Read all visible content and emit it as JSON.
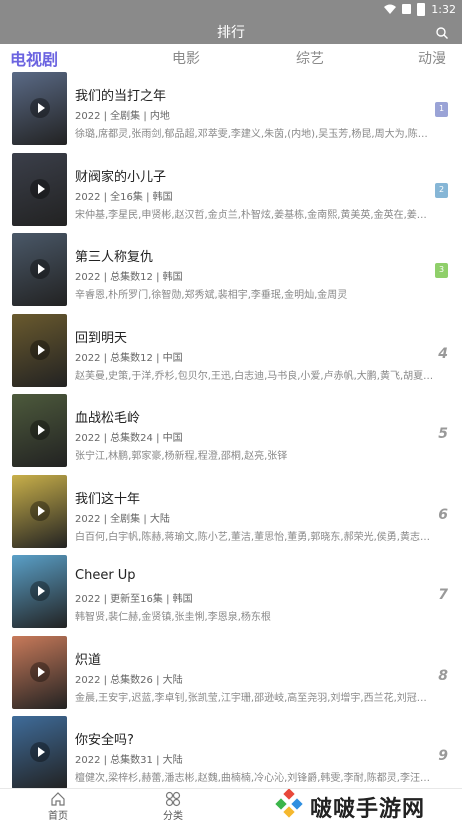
{
  "status_bar": {
    "time": "1:32"
  },
  "header": {
    "title": "排行",
    "search_icon": "search-icon"
  },
  "tabs": [
    {
      "label": "电视剧",
      "active": true
    },
    {
      "label": "电影",
      "active": false
    },
    {
      "label": "综艺",
      "active": false
    },
    {
      "label": "动漫",
      "active": false
    }
  ],
  "items": [
    {
      "title": "我们的当打之年",
      "meta": "2022 | 全剧集 | 内地",
      "cast": "徐璐,席都灵,张雨剑,郁品超,邓萃雯,李建义,朱茵,(内地),吴玉芳,杨昆,周大为,陈昊蕴",
      "rank": "1",
      "badge_color": "#9aa3d6",
      "poster_color": "#5a6a86"
    },
    {
      "title": "财阀家的小儿子",
      "meta": "2022 | 全16集 | 韩国",
      "cast": "宋仲基,李星民,申贤彬,赵汉哲,金贞兰,朴智炫,姜基栋,金南熙,黄美英,金英在,姜吉宇",
      "rank": "2",
      "badge_color": "#86b6d6",
      "poster_color": "#3b3f4a"
    },
    {
      "title": "第三人称复仇",
      "meta": "2022 | 总集数12 | 韩国",
      "cast": "辛睿恩,朴所罗门,徐智勋,郑秀斌,裴相宇,李垂珉,金明灿,金周灵",
      "rank": "3",
      "badge_color": "#8fcf6a",
      "poster_color": "#4a5868"
    },
    {
      "title": "回到明天",
      "meta": "2022 | 总集数12 | 中国",
      "cast": "赵芙曼,史策,于洋,乔杉,包贝尔,王迅,白志迪,马书良,小爱,卢赤帆,大鹏,黄飞,胡夏,白客,崔志佳",
      "rank": "4",
      "badge_color": "",
      "poster_color": "#6a5a2e"
    },
    {
      "title": "血战松毛岭",
      "meta": "2022 | 总集数24 | 中国",
      "cast": "张宁江,林鹏,郭家豪,杨新程,程澄,邵桐,赵亮,张铎",
      "rank": "5",
      "badge_color": "",
      "poster_color": "#4d5a3c"
    },
    {
      "title": "我们这十年",
      "meta": "2022 | 全剧集 | 大陆",
      "cast": "白百何,白宇帆,陈赫,蒋瑜文,陈小艺,董洁,董思怡,董勇,郭晓东,郝荣光,侯勇,黄志忠,焦俊艳",
      "rank": "6",
      "badge_color": "",
      "poster_color": "#c9b04a"
    },
    {
      "title": "Cheer Up",
      "meta": "2022 | 更新至16集 | 韩国",
      "cast": "韩智贤,裴仁赫,金贤镇,张圭悧,李恩泉,杨东根",
      "rank": "7",
      "badge_color": "",
      "poster_color": "#5aa0c8"
    },
    {
      "title": "炽道",
      "meta": "2022 | 总集数26 | 大陆",
      "cast": "金晨,王安宇,迟蓝,李卓钊,张凯莹,江宇珊,邵逊岐,高至尧羽,刘增宇,西兰花,刘冠成,徐浩儿",
      "rank": "8",
      "badge_color": "",
      "poster_color": "#c87a5a"
    },
    {
      "title": "你安全吗?",
      "meta": "2022 | 总集数31 | 大陆",
      "cast": "檀健次,梁梓杉,赫蕾,潘志彬,赵魏,曲楠楠,冷心沁,刘锋爵,韩雯,李耐,陈都灵,李汪霖,梁大维",
      "rank": "9",
      "badge_color": "",
      "poster_color": "#3f6c9a"
    }
  ],
  "bottom_nav": [
    {
      "label": "首页",
      "icon": "home-icon"
    },
    {
      "label": "分类",
      "icon": "category-icon"
    }
  ],
  "watermark": {
    "text": "啵啵手游网"
  }
}
